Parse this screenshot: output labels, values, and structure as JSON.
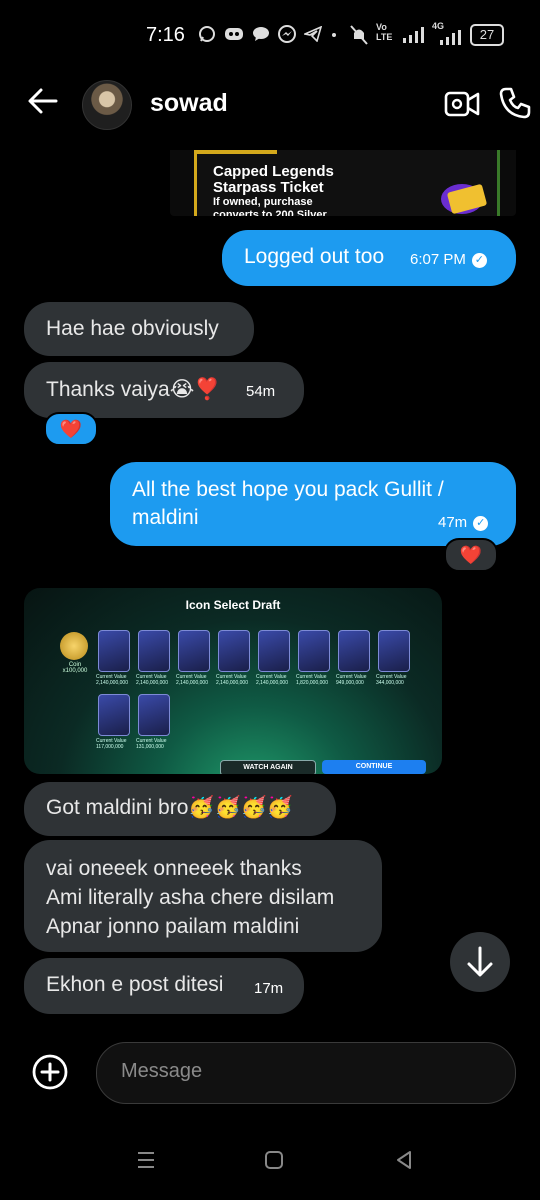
{
  "status_bar": {
    "time": "7:16",
    "battery": "27",
    "icons": [
      "whatsapp-icon",
      "discord-icon",
      "chat-icon",
      "messenger-icon",
      "telegram-icon",
      "dot",
      "mute-icon",
      "volte-icon",
      "signal-icon",
      "4g-signal-icon"
    ],
    "volte_label": "Vo LTE",
    "network_label": "4G"
  },
  "header": {
    "contact_name": "sowad",
    "back_icon": "arrow-left-icon",
    "video_icon": "video-call-icon",
    "phone_icon": "phone-call-icon"
  },
  "preview_card": {
    "title": "Capped Legends\nStarpass Ticket",
    "subtitle": "If owned, purchase\nconverts to 200 Silver"
  },
  "messages": [
    {
      "id": "m1",
      "direction": "out",
      "text": "Logged out too",
      "time": "6:07 PM",
      "read": true
    },
    {
      "id": "m2",
      "direction": "in",
      "text": "Hae hae obviously"
    },
    {
      "id": "m3",
      "direction": "in",
      "text": "Thanks vaiya😭❣️",
      "time": "54m",
      "reaction": "❤️"
    },
    {
      "id": "m4",
      "direction": "out",
      "text": "All the best hope you pack Gullit /\nmaldini",
      "time": "47m",
      "read": true,
      "reaction": "❤️"
    },
    {
      "id": "m5",
      "direction": "in",
      "type": "image"
    },
    {
      "id": "m6",
      "direction": "in",
      "text": "Got maldini bro🥳🥳🥳🥳"
    },
    {
      "id": "m7",
      "direction": "in",
      "text": "vai oneeek onneeek thanks\nAmi literally asha chere disilam\nApnar jonno pailam maldini"
    },
    {
      "id": "m8",
      "direction": "in",
      "text": "Ekhon e post ditesi",
      "time": "17m"
    }
  ],
  "media": {
    "title": "Icon Select Draft",
    "coin_label": "Coin",
    "coin_amount": "x100,000",
    "value_label": "Current Value",
    "card_values": [
      "2,140,000,000",
      "2,140,000,000",
      "2,140,000,000",
      "2,140,000,000",
      "2,140,000,000",
      "1,820,000,000",
      "949,000,000",
      "344,000,000",
      "117,000,000",
      "131,000,000"
    ],
    "watch_again": "WATCH AGAIN",
    "continue": "CONTINUE"
  },
  "composer": {
    "placeholder": "Message",
    "add_icon": "plus-circle-icon"
  },
  "nav_bar": {
    "icons": [
      "menu-icon",
      "home-icon",
      "back-icon"
    ]
  },
  "colors": {
    "outgoing_bubble": "#1d9bf0",
    "incoming_bubble": "#2f3336",
    "background": "#000000",
    "reaction_heart": "#e0263b"
  }
}
